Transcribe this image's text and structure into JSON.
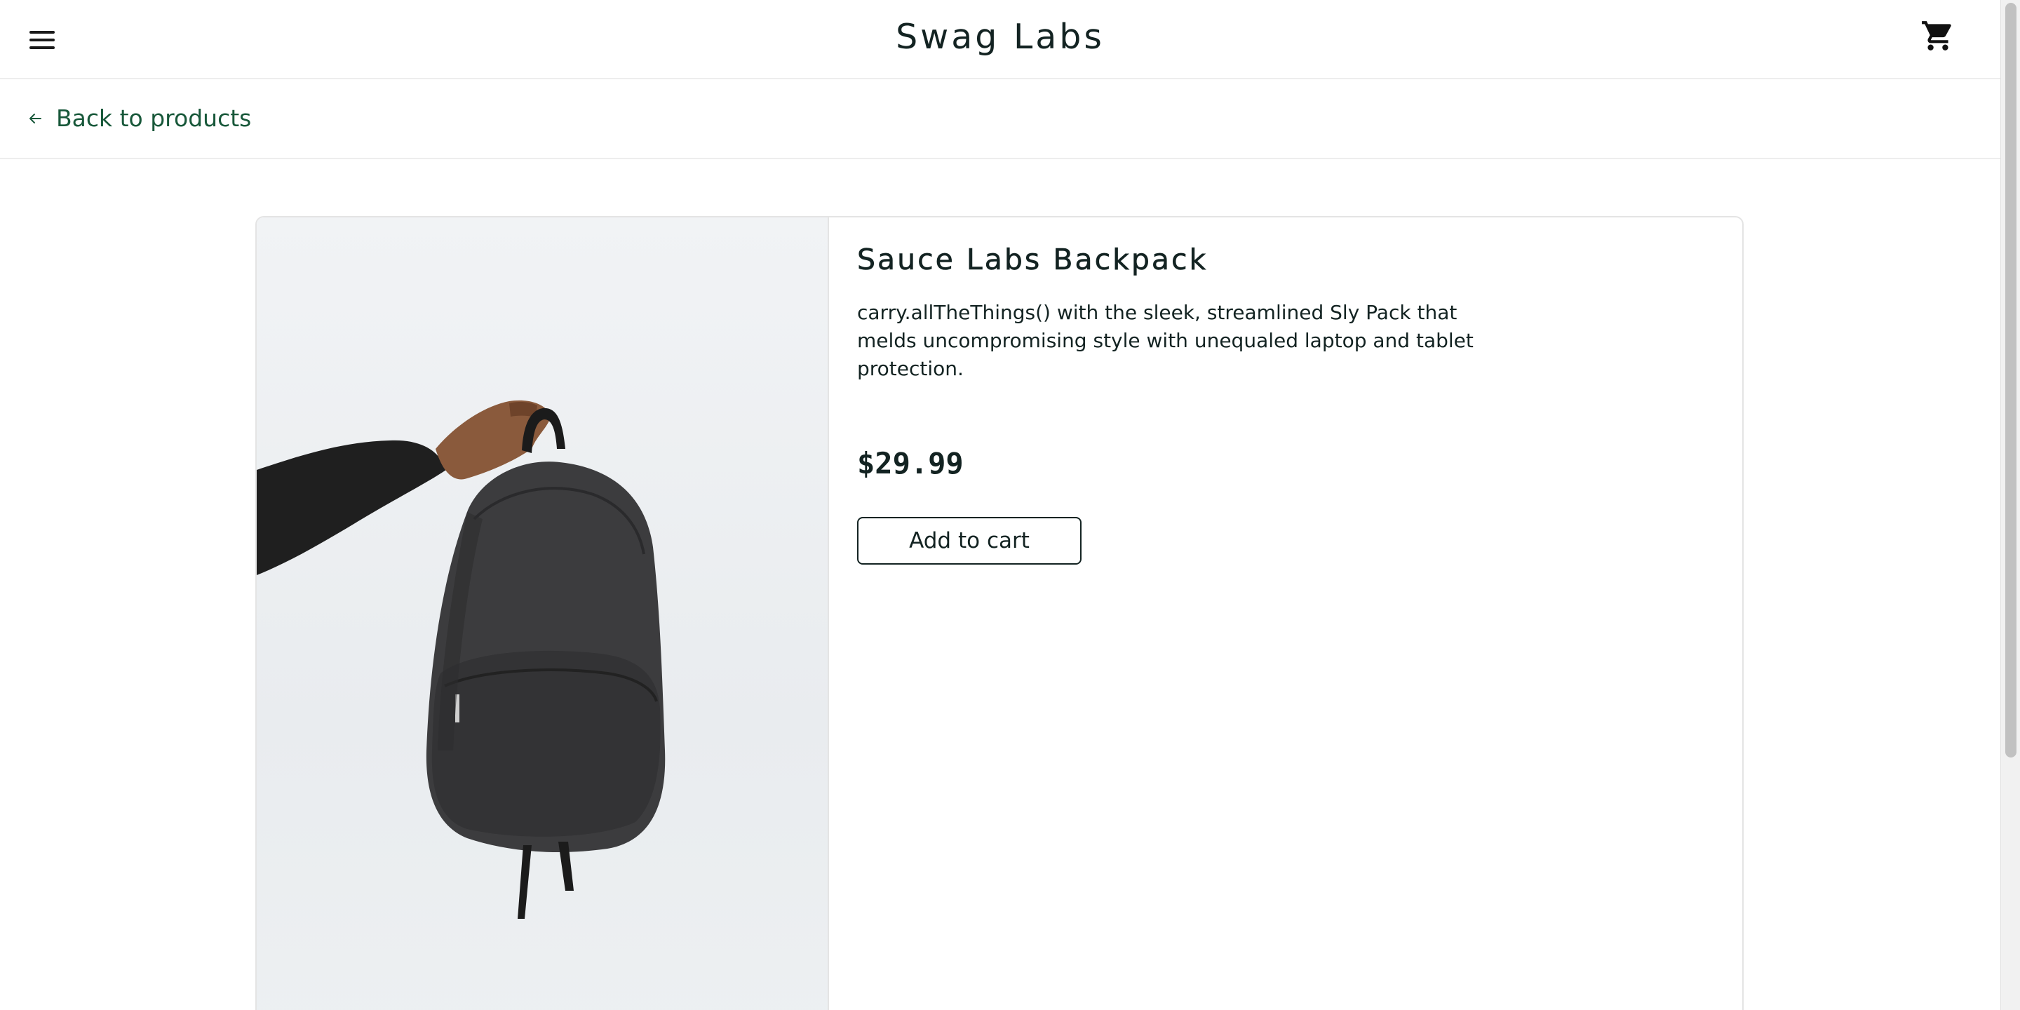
{
  "header": {
    "title": "Swag Labs",
    "menu_icon": "hamburger-menu-icon",
    "cart_icon": "shopping-cart-icon"
  },
  "subheader": {
    "back_label": "Back to products",
    "back_icon": "arrow-left-icon"
  },
  "product": {
    "name": "Sauce Labs Backpack",
    "description": "carry.allTheThings() with the sleek, streamlined Sly Pack that melds uncompromising style with unequaled laptop and tablet protection.",
    "price": "$29.99",
    "add_to_cart_label": "Add to cart",
    "image_alt": "Sauce Labs Backpack"
  },
  "colors": {
    "accent_green": "#18583a",
    "text": "#132322",
    "border": "#e4e4e4"
  }
}
